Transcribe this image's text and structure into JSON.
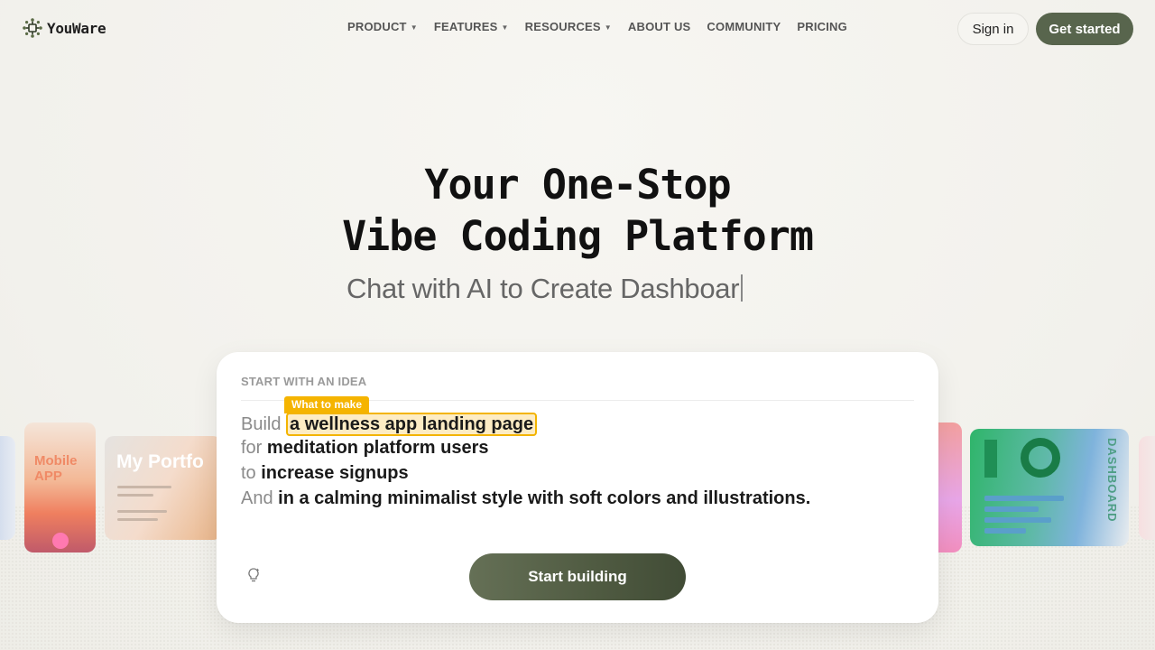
{
  "brand": {
    "name": "YouWare"
  },
  "nav": {
    "items": [
      {
        "label": "PRODUCT",
        "dropdown": true
      },
      {
        "label": "FEATURES",
        "dropdown": true
      },
      {
        "label": "RESOURCES",
        "dropdown": true
      },
      {
        "label": "ABOUT US",
        "dropdown": false
      },
      {
        "label": "COMMUNITY",
        "dropdown": false
      },
      {
        "label": "PRICING",
        "dropdown": false
      }
    ],
    "sign_in": "Sign in",
    "get_started": "Get started"
  },
  "hero": {
    "title_line1": "Your One-Stop",
    "title_line2": "Vibe Coding Platform",
    "subtitle": "Chat with AI to Create Dashboar"
  },
  "cards": {
    "mobile_app": "Mobile APP",
    "portfolio": "My Portfo",
    "dashboard": "DASHBOARD"
  },
  "panel": {
    "label": "START WITH AN IDEA",
    "tag": "What to make",
    "lines": [
      {
        "keyword": "Build",
        "value": "a wellness app landing page"
      },
      {
        "keyword": "for",
        "value": "meditation platform users"
      },
      {
        "keyword": "to",
        "value": "increase signups"
      },
      {
        "keyword": "And",
        "value": "in a calming minimalist style with soft colors and illustrations."
      }
    ],
    "cta": "Start building"
  },
  "colors": {
    "accent": "#58654d",
    "highlight": "#f5b400",
    "background": "#f4f3ef"
  },
  "icons": {
    "logo": "youware-logo-icon",
    "idea": "lightbulb-icon",
    "dropdown": "chevron-down-icon"
  }
}
